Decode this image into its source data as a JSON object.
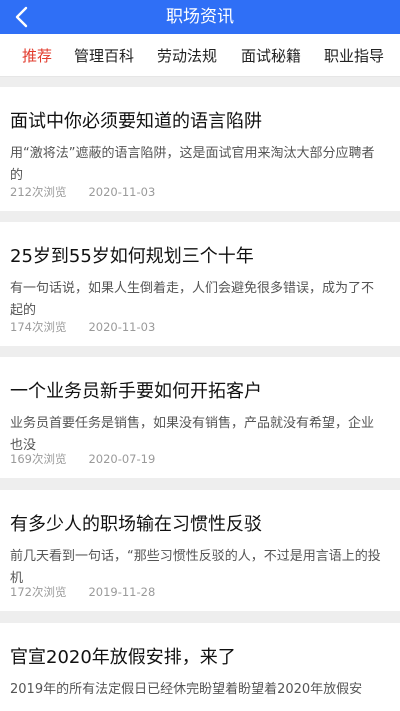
{
  "header": {
    "title": "职场资讯",
    "back_icon": "chevron-left-icon"
  },
  "tabs": [
    {
      "label": "推荐",
      "active": true
    },
    {
      "label": "管理百科",
      "active": false
    },
    {
      "label": "劳动法规",
      "active": false
    },
    {
      "label": "面试秘籍",
      "active": false
    },
    {
      "label": "职业指导",
      "active": false
    }
  ],
  "articles": [
    {
      "title": "面试中你必须要知道的语言陷阱",
      "summary": "用“激将法”遮蔽的语言陷阱，这是面试官用来淘汰大部分应聘者的",
      "views": "212次浏览",
      "date": "2020-11-03"
    },
    {
      "title": "25岁到55岁如何规划三个十年",
      "summary": "有一句话说，如果人生倒着走，人们会避免很多错误，成为了不起的",
      "views": "174次浏览",
      "date": "2020-11-03"
    },
    {
      "title": "一个业务员新手要如何开拓客户",
      "summary": "业务员首要任务是销售，如果没有销售，产品就没有希望，企业也没",
      "views": "169次浏览",
      "date": "2020-07-19"
    },
    {
      "title": "有多少人的职场输在习惯性反驳",
      "summary": "前几天看到一句话，“那些习惯性反驳的人，不过是用言语上的投机",
      "views": "172次浏览",
      "date": "2019-11-28"
    },
    {
      "title": "官宣2020年放假安排，来了",
      "summary": "2019年的所有法定假日已经休完盼望着盼望着2020年放假安",
      "views": "",
      "date": ""
    }
  ]
}
